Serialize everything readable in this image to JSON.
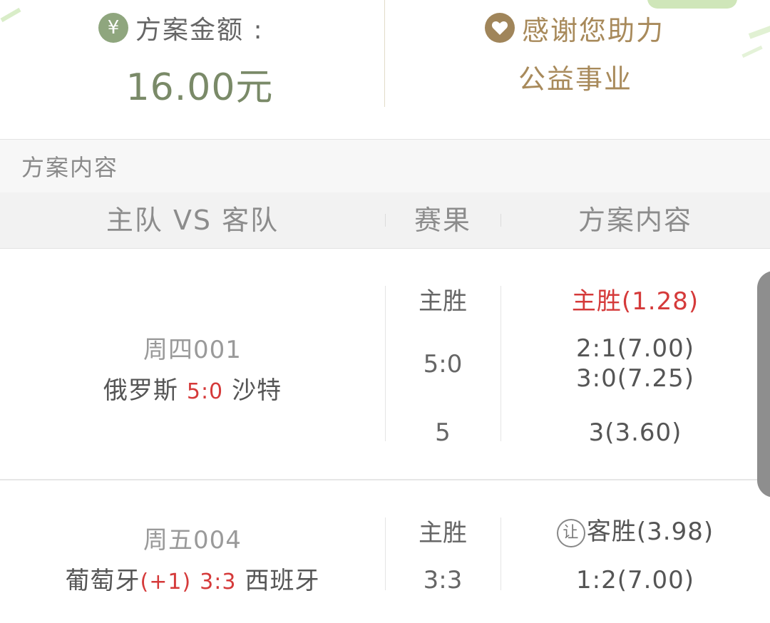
{
  "summary": {
    "amount_label": "方案金额 :",
    "amount_value": "16.00元",
    "yen_icon": "yen-icon",
    "thanks_line1": "感谢您助力",
    "thanks_line2": "公益事业",
    "heart_icon": "heart-icon"
  },
  "section": {
    "title": "方案内容"
  },
  "columns": {
    "teams": "主队 VS 客队",
    "result": "赛果",
    "content": "方案内容"
  },
  "matches": [
    {
      "match_no": "周四001",
      "home": "俄罗斯",
      "score": "5:0",
      "away": "沙特",
      "rows": [
        {
          "result": "主胜",
          "picks": [
            "主胜(1.28)"
          ]
        },
        {
          "result": "5:0",
          "picks": [
            "2:1(7.00)",
            "3:0(7.25)"
          ]
        },
        {
          "result": "5",
          "picks": [
            "3(3.60)"
          ]
        }
      ]
    },
    {
      "match_no": "周五004",
      "home": "葡萄牙",
      "handicap": "(+1)",
      "score": "3:3",
      "away": "西班牙",
      "rows": [
        {
          "result": "主胜",
          "rang_icon": "让",
          "picks": [
            "客胜(3.98)"
          ]
        },
        {
          "result": "3:3",
          "picks": [
            "1:2(7.00)"
          ]
        }
      ]
    }
  ],
  "colors": {
    "accent_red": "#d53a3a",
    "gold": "#a88a5b",
    "green": "#7a8a68"
  }
}
